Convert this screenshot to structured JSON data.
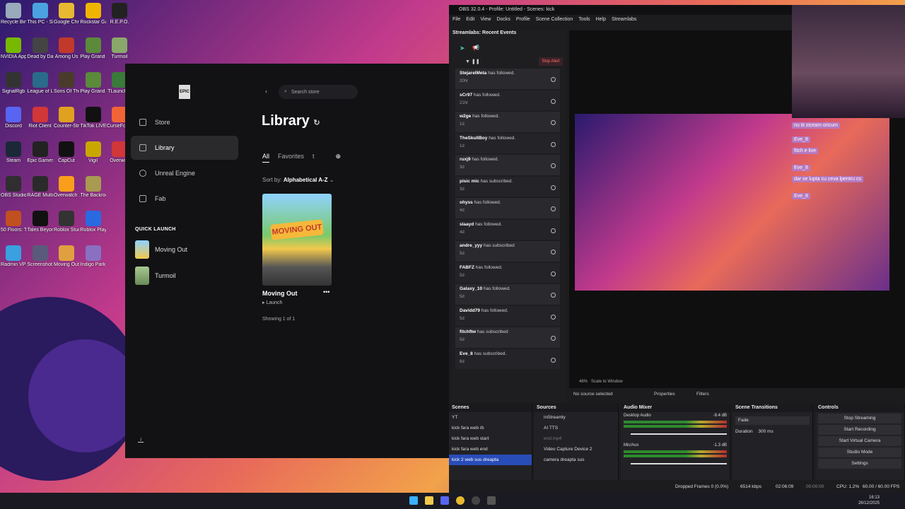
{
  "desktop": {
    "icons": [
      {
        "label": "Recycle Bin",
        "color": "#9ab"
      },
      {
        "label": "This PC - Shortcut",
        "color": "#4aa3e0"
      },
      {
        "label": "Google Chrome",
        "color": "#e8b930"
      },
      {
        "label": "Rockstar Games...",
        "color": "#f0b400"
      },
      {
        "label": "R.E.P.O.",
        "color": "#222"
      },
      {
        "label": "NVIDIA App",
        "color": "#76b900"
      },
      {
        "label": "Dead by Daylight",
        "color": "#444"
      },
      {
        "label": "Among Us",
        "color": "#c0392b"
      },
      {
        "label": "Play Grand Theft Auto...",
        "color": "#5a8a3a"
      },
      {
        "label": "Turmoil",
        "color": "#8aa86a"
      },
      {
        "label": "SignalRgb",
        "color": "#333"
      },
      {
        "label": "League of Legends",
        "color": "#2a6a8a"
      },
      {
        "label": "Sons Of The Forest",
        "color": "#4a3a2a"
      },
      {
        "label": "Play Grand Theft Auto...",
        "color": "#5a8a3a"
      },
      {
        "label": "TLauncher",
        "color": "#3a7a3a"
      },
      {
        "label": "Discord",
        "color": "#5865f2"
      },
      {
        "label": "Riot Client",
        "color": "#d13639"
      },
      {
        "label": "Counter-Strike 2",
        "color": "#e0a020"
      },
      {
        "label": "TikTok LIVE Studio",
        "color": "#111"
      },
      {
        "label": "CurseForge",
        "color": "#f16436"
      },
      {
        "label": "Steam",
        "color": "#1b2838"
      },
      {
        "label": "Epic Games Launcher",
        "color": "#222"
      },
      {
        "label": "CapCut",
        "color": "#111"
      },
      {
        "label": "Vigil",
        "color": "#c8a800"
      },
      {
        "label": "Overwolf",
        "color": "#d13639"
      },
      {
        "label": "OBS Studio",
        "color": "#302e31"
      },
      {
        "label": "RAGE Multiplayer",
        "color": "#2a2a2a"
      },
      {
        "label": "Overwatch 2",
        "color": "#f99e1a"
      },
      {
        "label": "The Backrooms",
        "color": "#a89a50"
      },
      {
        "label": "",
        "color": ""
      },
      {
        "label": "50 Floors: The Paranormal...",
        "color": "#c05020"
      },
      {
        "label": "Tales Beyond The Tomb",
        "color": "#111"
      },
      {
        "label": "Roblox Studio",
        "color": "#333"
      },
      {
        "label": "Roblox Player",
        "color": "#2a6ae0"
      },
      {
        "label": "",
        "color": ""
      },
      {
        "label": "Radmin VPN",
        "color": "#3aa0e0"
      },
      {
        "label": "Screenshot 2025-12-23...",
        "color": "#5a5a7a"
      },
      {
        "label": "Moving Out",
        "color": "#e0a040"
      },
      {
        "label": "Indigo Park",
        "color": "#8a70c0"
      },
      {
        "label": "",
        "color": ""
      }
    ]
  },
  "epic": {
    "logo": "EPIC",
    "nav": [
      {
        "label": "Store",
        "icon": "store-icon"
      },
      {
        "label": "Library",
        "icon": "library-icon"
      },
      {
        "label": "Unreal Engine",
        "icon": "unreal-icon"
      },
      {
        "label": "Fab",
        "icon": "fab-icon"
      }
    ],
    "quick_launch_title": "QUICK LAUNCH",
    "quick_launch": [
      "Moving Out",
      "Turmoil"
    ],
    "search_placeholder": "Search store",
    "title": "Library",
    "tabs": [
      "All",
      "Favorites",
      "t"
    ],
    "sort_label": "Sort by:",
    "sort_value": "Alphabetical A-Z",
    "game": {
      "name": "Moving Out",
      "launch": "Launch",
      "logo": "MOVING OUT"
    },
    "showing": "Showing 1 of 1"
  },
  "obs": {
    "title": "OBS 32.0.4 - Profile: Untitled - Scenes: kick",
    "menu": [
      "File",
      "Edit",
      "View",
      "Docks",
      "Profile",
      "Scene Collection",
      "Tools",
      "Help",
      "Streamlabs"
    ],
    "events_title": "Streamlabs: Recent Events",
    "skip_alert": "Skip Alert",
    "events": [
      {
        "name": "StejarelMeta",
        "action": "has followed.",
        "ago": "20hr"
      },
      {
        "name": "sCr97",
        "action": "has followed.",
        "ago": "21hr"
      },
      {
        "name": "w2ge",
        "action": "has followed.",
        "ago": "1d"
      },
      {
        "name": "TheSkullBoy",
        "action": "has followed.",
        "ago": "1d"
      },
      {
        "name": "ruxj9",
        "action": "has followed.",
        "ago": "3d"
      },
      {
        "name": "pisic mic",
        "action": "has subscribed.",
        "ago": "3d"
      },
      {
        "name": "ohyss",
        "action": "has followed.",
        "ago": "4d"
      },
      {
        "name": "slaayd",
        "action": "has followed.",
        "ago": "4d"
      },
      {
        "name": "andre_yyy",
        "action": "has subscribed",
        "ago": "5d"
      },
      {
        "name": "FABFZ",
        "action": "has followed.",
        "ago": "5d"
      },
      {
        "name": "Galaxy_10",
        "action": "has followed.",
        "ago": "5d"
      },
      {
        "name": "Davidd79",
        "action": "has followed.",
        "ago": "5d"
      },
      {
        "name": "fitchftw",
        "action": "has subscribed",
        "ago": "5d"
      },
      {
        "name": "Eve_8",
        "action": "has subscribed.",
        "ago": "6d"
      }
    ],
    "chat": [
      "nu iti ziceam oricum",
      "Eve_8",
      "fitch e live",
      "Eve_8",
      "dar se lupta cu ceva lpentru cs",
      "Eve_8"
    ],
    "zoom": "46%",
    "scale": "Scale to Window",
    "no_source": "No source selected",
    "properties": "Properties",
    "filters": "Filters",
    "scenes_title": "Scenes",
    "scenes": [
      "YT",
      "kick fara web rb",
      "kick fara web start",
      "kick fara web end",
      "kick 2 web sus dreapta"
    ],
    "sources_title": "Sources",
    "sources": [
      "inStreamly",
      "AI TTS",
      "end.mp4",
      "Video Capture Device 2",
      "camera dreapta sus"
    ],
    "mixer_title": "Audio Mixer",
    "mixer": [
      {
        "name": "Desktop Audio",
        "db": "-9.4 dB"
      },
      {
        "name": "Mic/Aux",
        "db": "-1.3 dB"
      }
    ],
    "transitions_title": "Scene Transitions",
    "transition": "Fade",
    "duration_label": "Duration",
    "duration": "300 ms",
    "controls_title": "Controls",
    "controls": [
      "Stop Streaming",
      "Start Recording",
      "Start Virtual Camera",
      "Studio Mode",
      "Settings"
    ],
    "status": {
      "dropped": "Dropped Frames 0 (0.0%)",
      "kbps": "6514 kbps",
      "live": "02:06:09",
      "rec": "00:00:00",
      "cpu": "CPU: 1.2%",
      "fps": "60.00 / 60.00 FPS"
    }
  },
  "taskbar": {
    "time": "16:13",
    "date": "26/12/2025"
  }
}
